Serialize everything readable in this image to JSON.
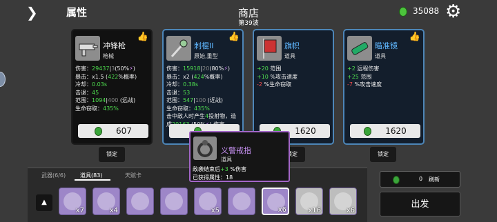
{
  "header": {
    "attributes_label": "属性",
    "shop_title": "商店",
    "wave": "第39波",
    "coins": "35088"
  },
  "cards": [
    {
      "name": "冲锋枪",
      "type": "枪械",
      "price": "607",
      "stats": [
        [
          "伤害：",
          "29437",
          "|",
          "3",
          "(50%",
          "⚡",
          ")"
        ],
        [
          "暴击：x1.5 (",
          "422",
          "%概率)"
        ],
        [
          "冷却：",
          "0.03s"
        ],
        [
          "击退：",
          "45"
        ],
        [
          "范围：",
          "1094",
          "|",
          "400",
          " (远战)"
        ],
        [
          "生命窃取：",
          "435%"
        ]
      ]
    },
    {
      "name": "刺棍II",
      "type": "原始,重型",
      "price": "",
      "stats": [
        [
          "伤害：",
          "15918",
          "|",
          "20",
          "(80%",
          "⚡",
          ")"
        ],
        [
          "暴击：x2 (",
          "424",
          "%概率)"
        ],
        [
          "冷却：",
          "0.38s"
        ],
        [
          "击退：",
          "53"
        ],
        [
          "范围：",
          "547",
          "|",
          "100",
          " (近战)"
        ],
        [
          "生命窃取：",
          "435%"
        ],
        [
          "击中敌人时产生",
          "4",
          "投射物，造"
        ],
        [
          "成",
          "29163",
          " (50%",
          "⚡",
          ") 伤害"
        ]
      ]
    },
    {
      "name": "旗帜",
      "type": "道具",
      "price": "1620",
      "stats": [
        [
          "+20",
          " 范围"
        ],
        [
          "+10",
          " %攻击速度"
        ],
        [
          "-2",
          " %生命窃取"
        ]
      ]
    },
    {
      "name": "瞄准镜",
      "type": "道具",
      "price": "1620",
      "stats": [
        [
          "+2",
          " 远程伤害"
        ],
        [
          "+25",
          " 范围"
        ],
        [
          "-7",
          " %攻击速度"
        ]
      ]
    }
  ],
  "lock_label": "锁定",
  "tooltip": {
    "name": "义警戒指",
    "type": "道具",
    "line1_a": "敌袭结束后",
    "line1_b": "+3",
    "line1_c": " %伤害",
    "line2": "已获得属性：18"
  },
  "tabs": {
    "weapons": "武器(6/6)",
    "items": "道具(83)",
    "talents": "天赋卡"
  },
  "inventory": [
    {
      "name": "item-1",
      "qty": "x7",
      "color": "#9d86c8"
    },
    {
      "name": "item-2",
      "qty": "x4",
      "color": "#9d86c8"
    },
    {
      "name": "item-3",
      "qty": "",
      "color": "#9d86c8"
    },
    {
      "name": "item-4",
      "qty": "",
      "color": "#9d86c8"
    },
    {
      "name": "item-5",
      "qty": "x5",
      "color": "#9d86c8"
    },
    {
      "name": "item-6",
      "qty": "",
      "color": "#9d86c8"
    },
    {
      "name": "item-7",
      "qty": "x6",
      "color": "#9d86c8"
    },
    {
      "name": "item-8",
      "qty": "x16",
      "color": "#bdbdbd"
    },
    {
      "name": "item-9",
      "qty": "x6",
      "color": "#bdbdbd"
    }
  ],
  "reroll": {
    "cost": "0",
    "label": "刷新"
  },
  "go_label": "出发"
}
